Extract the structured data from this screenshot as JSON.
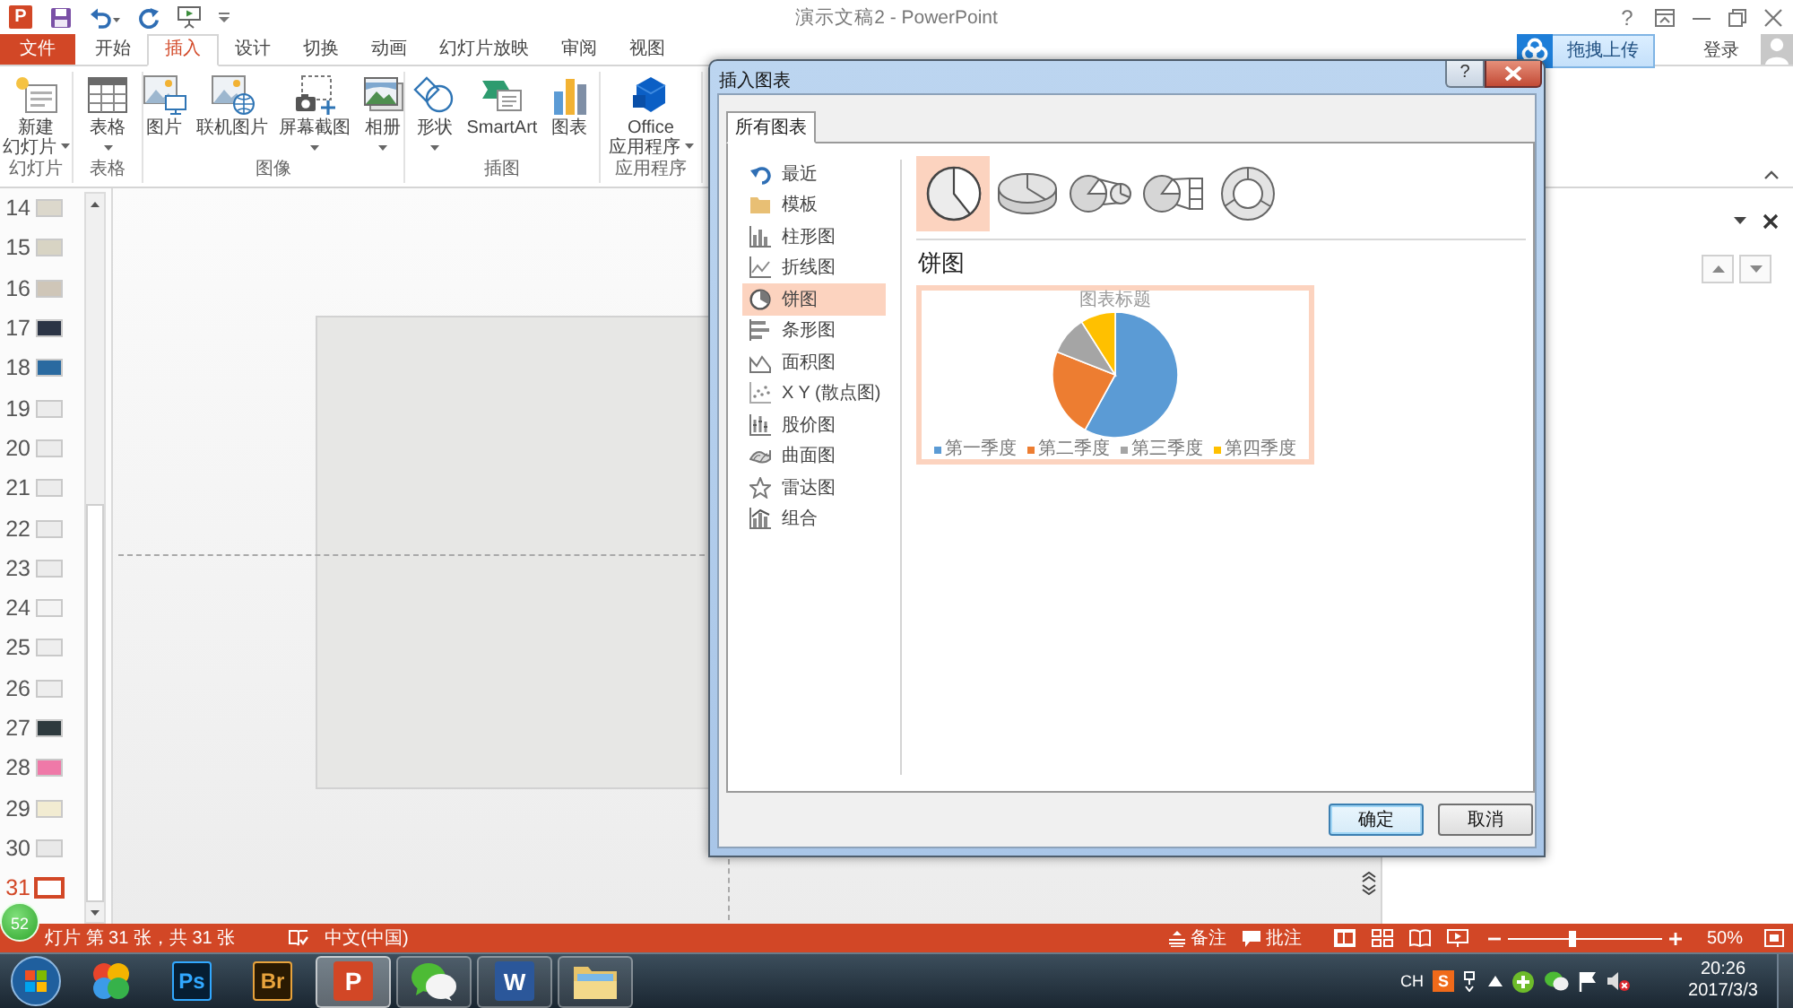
{
  "title_bar": {
    "logo": "P",
    "quick_access": [
      {
        "kind": "save"
      },
      {
        "kind": "undo"
      },
      {
        "kind": "repeat"
      },
      {
        "kind": "present"
      },
      {
        "kind": "customize"
      }
    ],
    "title": "演示文稿2 - PowerPoint",
    "help": "?"
  },
  "ribbon_tabs": [
    {
      "label": "文件",
      "kind": "backstage",
      "selected": false
    },
    {
      "label": "开始",
      "kind": "tab",
      "selected": false
    },
    {
      "label": "插入",
      "kind": "tab",
      "selected": true
    },
    {
      "label": "设计",
      "kind": "tab",
      "selected": false
    },
    {
      "label": "切换",
      "kind": "tab",
      "selected": false
    },
    {
      "label": "动画",
      "kind": "tab",
      "selected": false
    },
    {
      "label": "幻灯片放映",
      "kind": "tab",
      "selected": false
    },
    {
      "label": "审阅",
      "kind": "tab",
      "selected": false
    },
    {
      "label": "视图",
      "kind": "tab",
      "selected": false
    }
  ],
  "upload_button": {
    "label": "拖拽上传"
  },
  "account": {
    "label": "登录"
  },
  "ribbon_groups": [
    {
      "label": "幻灯片",
      "commands": [
        {
          "kind": "new-slide",
          "lines": [
            "新建",
            "幻灯片"
          ],
          "dropdown": true
        }
      ]
    },
    {
      "label": "表格",
      "commands": [
        {
          "kind": "table",
          "lines": [
            "表格"
          ],
          "dropdown": true
        }
      ]
    },
    {
      "label": "图像",
      "commands": [
        {
          "kind": "picture",
          "lines": [
            "图片"
          ],
          "dropdown": false
        },
        {
          "kind": "online-picture",
          "lines": [
            "联机图片"
          ],
          "dropdown": false
        },
        {
          "kind": "screenshot",
          "lines": [
            "屏幕截图"
          ],
          "dropdown": true
        },
        {
          "kind": "album",
          "lines": [
            "相册"
          ],
          "dropdown": true
        }
      ]
    },
    {
      "label": "插图",
      "commands": [
        {
          "kind": "shapes",
          "lines": [
            "形状"
          ],
          "dropdown": true
        },
        {
          "kind": "smartart",
          "lines": [
            "SmartArt"
          ],
          "dropdown": false
        },
        {
          "kind": "chart",
          "lines": [
            "图表"
          ],
          "dropdown": false
        }
      ]
    },
    {
      "label": "应用程序",
      "commands": [
        {
          "kind": "office-apps",
          "lines": [
            "Office",
            "应用程序"
          ],
          "dropdown": true
        }
      ]
    }
  ],
  "slides": [
    {
      "number": "14",
      "color": "#dcd8cc",
      "selected": false
    },
    {
      "number": "15",
      "color": "#d8d4c4",
      "selected": false
    },
    {
      "number": "16",
      "color": "#cfc6b8",
      "selected": false
    },
    {
      "number": "17",
      "color": "#2b3445",
      "selected": false
    },
    {
      "number": "18",
      "color": "#2a6aa0",
      "selected": false
    },
    {
      "number": "19",
      "color": "#ececec",
      "selected": false
    },
    {
      "number": "20",
      "color": "#ececec",
      "selected": false
    },
    {
      "number": "21",
      "color": "#ececec",
      "selected": false
    },
    {
      "number": "22",
      "color": "#ececec",
      "selected": false
    },
    {
      "number": "23",
      "color": "#ececec",
      "selected": false
    },
    {
      "number": "24",
      "color": "#f4f4f4",
      "selected": false
    },
    {
      "number": "25",
      "color": "#eeeeee",
      "selected": false
    },
    {
      "number": "26",
      "color": "#eeeeee",
      "selected": false
    },
    {
      "number": "27",
      "color": "#2e3a3e",
      "selected": false
    },
    {
      "number": "28",
      "color": "#ef79a8",
      "selected": false
    },
    {
      "number": "29",
      "color": "#f2ecd2",
      "selected": false
    },
    {
      "number": "30",
      "color": "#e9e9e9",
      "selected": false
    },
    {
      "number": "31",
      "color": "#ffffff",
      "selected": true
    }
  ],
  "dialog": {
    "title": "插入图表",
    "help": "?",
    "tabs": [
      {
        "label": "所有图表",
        "selected": true
      }
    ],
    "categories": [
      {
        "kind": "recent",
        "label": "最近",
        "selected": false
      },
      {
        "kind": "template",
        "label": "模板",
        "selected": false
      },
      {
        "kind": "column",
        "label": "柱形图",
        "selected": false
      },
      {
        "kind": "line",
        "label": "折线图",
        "selected": false
      },
      {
        "kind": "pie",
        "label": "饼图",
        "selected": true
      },
      {
        "kind": "bar",
        "label": "条形图",
        "selected": false
      },
      {
        "kind": "area",
        "label": "面积图",
        "selected": false
      },
      {
        "kind": "scatter",
        "label": "X Y (散点图)",
        "selected": false
      },
      {
        "kind": "stock",
        "label": "股价图",
        "selected": false
      },
      {
        "kind": "surface",
        "label": "曲面图",
        "selected": false
      },
      {
        "kind": "radar",
        "label": "雷达图",
        "selected": false
      },
      {
        "kind": "combo",
        "label": "组合",
        "selected": false
      }
    ],
    "subtypes": [
      {
        "kind": "pie",
        "selected": true
      },
      {
        "kind": "pie-3d",
        "selected": false
      },
      {
        "kind": "pie-of-pie",
        "selected": false
      },
      {
        "kind": "bar-of-pie",
        "selected": false
      },
      {
        "kind": "doughnut",
        "selected": false
      }
    ],
    "heading": "饼图",
    "preview": {
      "title": "图表标题",
      "legend": [
        {
          "label": "第一季度",
          "color": "#5b9bd5"
        },
        {
          "label": "第二季度",
          "color": "#ed7d31"
        },
        {
          "label": "第三季度",
          "color": "#a5a5a5"
        },
        {
          "label": "第四季度",
          "color": "#ffc000"
        }
      ]
    },
    "buttons": [
      {
        "kind": "primary",
        "label": "确定"
      },
      {
        "kind": "secondary",
        "label": "取消"
      }
    ]
  },
  "status_bar": {
    "slide_info": "灯片 第 31 张，共 31 张",
    "language": "中文(中国)",
    "notes": "备注",
    "comments": "批注",
    "zoom": {
      "level": 0.42,
      "reading": "50%"
    }
  },
  "floating_ball": {
    "label": "52"
  },
  "taskbar": {
    "apps": [
      {
        "kind": "colorful",
        "running": false,
        "selected": false
      },
      {
        "kind": "photoshop",
        "label": "Ps",
        "running": false,
        "selected": false
      },
      {
        "kind": "bridge",
        "label": "Br",
        "running": false,
        "selected": false
      },
      {
        "kind": "powerpoint",
        "label": "P",
        "running": true,
        "selected": true
      },
      {
        "kind": "wechat",
        "running": true,
        "selected": false
      },
      {
        "kind": "word",
        "label": "W",
        "running": true,
        "selected": false
      },
      {
        "kind": "explorer",
        "running": true,
        "selected": false
      }
    ],
    "tray": {
      "language": "CH",
      "ime": "S",
      "time": "20:26",
      "date": "2017/3/3"
    }
  }
}
